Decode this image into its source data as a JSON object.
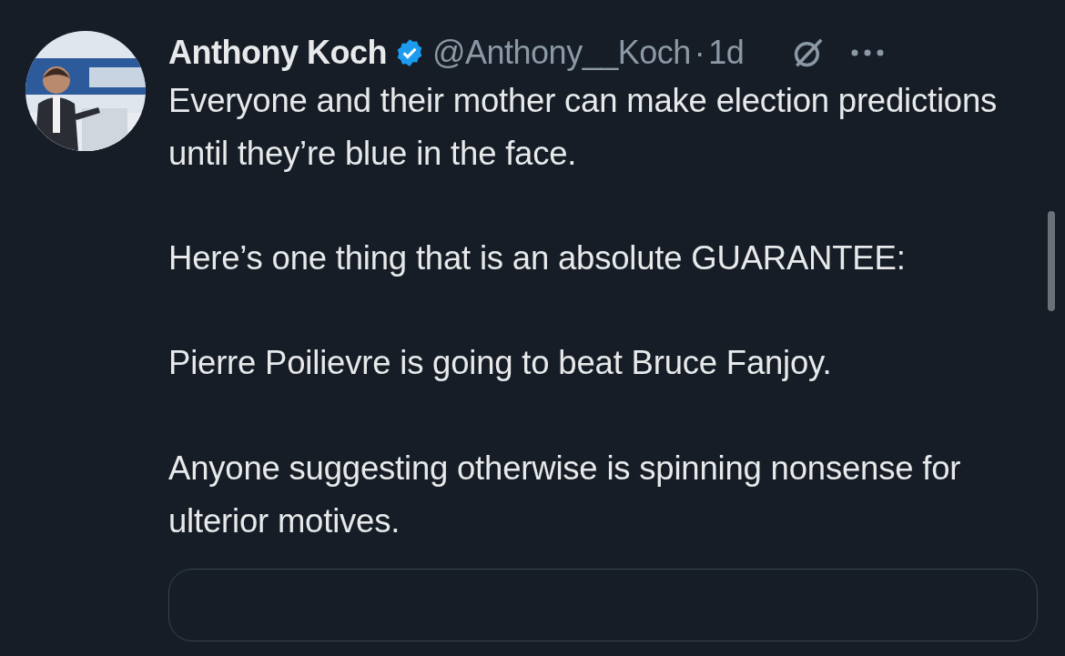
{
  "tweet": {
    "author_name": "Anthony Koch",
    "verified": true,
    "handle": "@Anthony__Koch",
    "separator": "·",
    "time": "1d",
    "paragraphs": [
      "Everyone and their mother can make election predictions until they’re blue in the face.",
      "Here’s one thing that is an absolute GUARANTEE:",
      "Pierre Poilievre is going to beat Bruce Fanjoy.",
      "Anyone suggesting otherwise is spinning nonsense for ulterior motives."
    ]
  }
}
